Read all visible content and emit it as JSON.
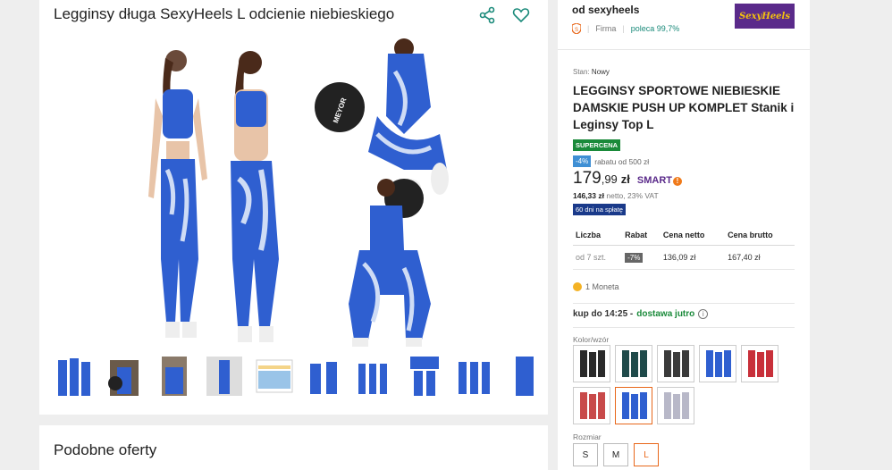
{
  "product": {
    "title": "Legginsy długa SexyHeels L odcienie niebieskiego",
    "share_icon": "share-icon",
    "favorite_icon": "heart-icon",
    "thumbnails_count": 10
  },
  "similar": {
    "title": "Podobne oferty"
  },
  "seller": {
    "name": "od sexyheels",
    "type": "Firma",
    "recommend": "poleca 99,7%",
    "logo_text": "SexyHeels"
  },
  "offer": {
    "state_label": "Stan:",
    "state_value": "Nowy",
    "title": "LEGGINSY SPORTOWE NIEBIESKIE DAMSKIE PUSH UP KOMPLET Stanik i Leginsy Top L",
    "supercena": "SUPERCENA",
    "discount_badge": "-4%",
    "discount_text": "rabatu od 500 zł",
    "price_main": "179",
    "price_cents": ",99",
    "price_currency": "zł",
    "smart_label": "SMART",
    "smart_mark": "!",
    "netto_value": "146,33 zł",
    "netto_text": "netto, 23% VAT",
    "installments": "60 dni na spłatę"
  },
  "quantity_table": {
    "headers": [
      "Liczba",
      "Rabat",
      "Cena netto",
      "Cena brutto"
    ],
    "row": {
      "qty": "od 7 szt.",
      "rabat": "-7%",
      "netto": "136,09 zł",
      "brutto": "167,40 zł"
    }
  },
  "coins": "1 Moneta",
  "delivery": {
    "prefix": "kup do 14:25 -",
    "status": "dostawa jutro",
    "info_icon": "i"
  },
  "colors": {
    "label": "Kolor/wzór",
    "selected_index": 6,
    "swatch_colors": [
      "#2a2a2a",
      "#1f4a4a",
      "#3a3a3a",
      "#2f5fd0",
      "#c8303a",
      "#c84a4a",
      "#2f5fd0",
      "#b8b8c8"
    ]
  },
  "sizes": {
    "label": "Rozmiar",
    "options": [
      "S",
      "M",
      "L"
    ],
    "selected": "L"
  },
  "accent_color": "#e8671a"
}
